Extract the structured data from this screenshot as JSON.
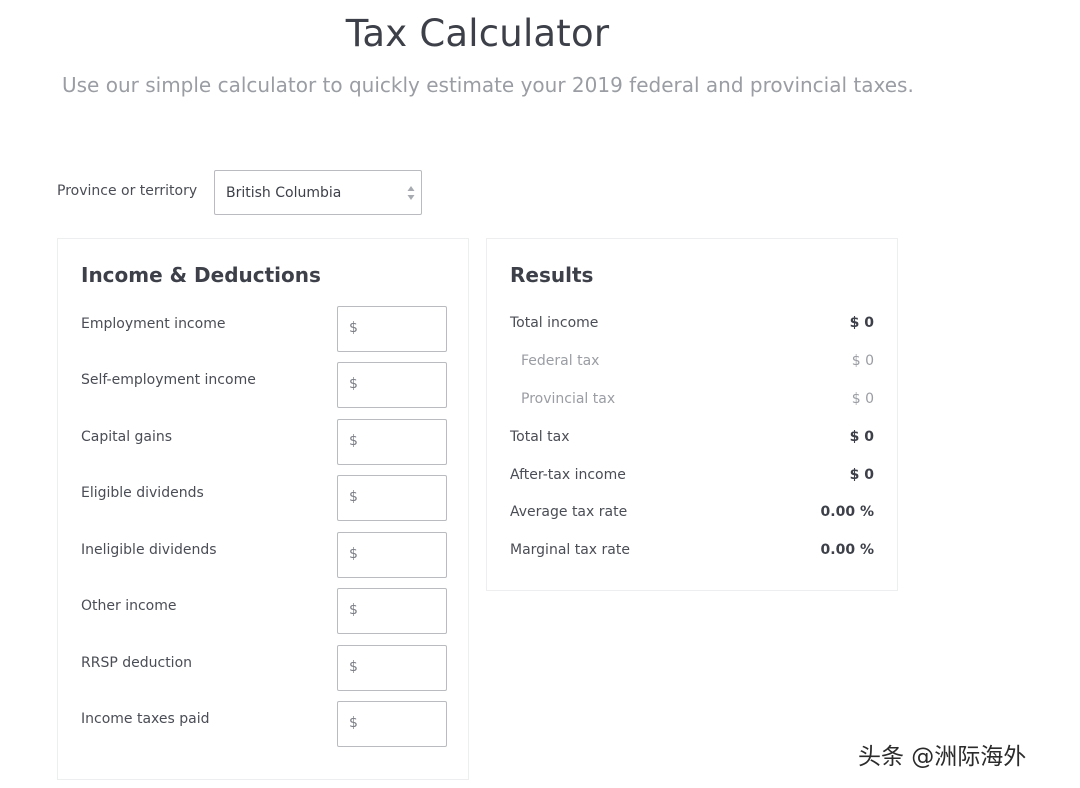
{
  "header": {
    "title": "Tax Calculator",
    "subtitle": "Use our simple calculator to quickly estimate your 2019 federal and provincial taxes."
  },
  "province": {
    "label": "Province or territory",
    "selected": "British Columbia"
  },
  "income": {
    "title": "Income & Deductions",
    "currency_prefix": "$",
    "fields": [
      {
        "label": "Employment income",
        "value": ""
      },
      {
        "label": "Self-employment income",
        "value": ""
      },
      {
        "label": "Capital gains",
        "value": ""
      },
      {
        "label": "Eligible dividends",
        "value": ""
      },
      {
        "label": "Ineligible dividends",
        "value": ""
      },
      {
        "label": "Other income",
        "value": ""
      },
      {
        "label": "RRSP deduction",
        "value": ""
      },
      {
        "label": "Income taxes paid",
        "value": ""
      }
    ]
  },
  "results": {
    "title": "Results",
    "rows": [
      {
        "label": "Total income",
        "value": "$ 0"
      },
      {
        "label": "Federal tax",
        "value": "$ 0"
      },
      {
        "label": "Provincial tax",
        "value": "$ 0"
      },
      {
        "label": "Total tax",
        "value": "$ 0"
      },
      {
        "label": "After-tax income",
        "value": "$ 0"
      },
      {
        "label": "Average tax rate",
        "value": "0.00 %"
      },
      {
        "label": "Marginal tax rate",
        "value": "0.00 %"
      }
    ]
  },
  "watermark": "头条 @洲际海外",
  "icons": {
    "select": "select-arrows-icon"
  }
}
